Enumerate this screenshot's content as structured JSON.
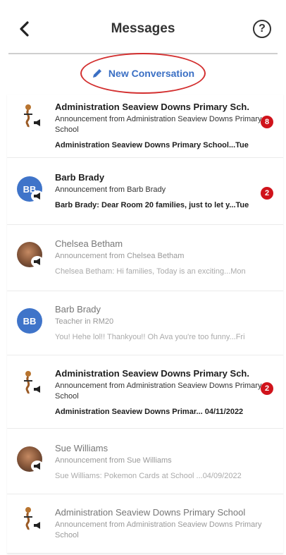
{
  "header": {
    "title": "Messages",
    "help_glyph": "?"
  },
  "new_conversation": {
    "label": "New Conversation"
  },
  "conversations": [
    {
      "name": "Administration Seaview Downs Primary Sch.",
      "subtitle": "Announcement from Administration Seaview Downs Primary School",
      "preview": "Administration Seaview Downs Primary School...Tue",
      "badge": "8",
      "avatar": "school-logo",
      "unread": true
    },
    {
      "name": "Barb Brady",
      "subtitle": "Announcement from Barb Brady",
      "preview": "Barb Brady: Dear Room 20 families, just to let y...Tue",
      "badge": "2",
      "avatar_initials": "BB",
      "unread": true
    },
    {
      "name": "Chelsea Betham",
      "subtitle": "Announcement from Chelsea Betham",
      "preview": "Chelsea Betham: Hi families, Today is an exciting...Mon",
      "avatar": "photo",
      "unread": false
    },
    {
      "name": "Barb Brady",
      "subtitle": "Teacher in RM20",
      "preview": "You! Hehe lol!! Thankyou!! Oh Ava you're too funny...Fri",
      "avatar_initials": "BB",
      "unread": false
    },
    {
      "name": "Administration Seaview Downs Primary Sch.",
      "subtitle": "Announcement from Administration Seaview Downs Primary School",
      "preview": "Administration Seaview Downs Primar... 04/11/2022",
      "badge": "2",
      "avatar": "school-logo",
      "unread": true
    },
    {
      "name": "Sue Williams",
      "subtitle": "Announcement from Sue Williams",
      "preview": "Sue Williams: Pokemon Cards at School ...04/09/2022",
      "avatar": "photo",
      "unread": false
    },
    {
      "name": "Administration Seaview Downs Primary School",
      "subtitle": "Announcement from Administration Seaview Downs Primary School",
      "avatar": "school-logo",
      "unread": false
    }
  ],
  "colors": {
    "accent": "#3a6fc4",
    "badge": "#d0131b",
    "highlight_ellipse": "#d32f2f"
  },
  "icons": {
    "back": "chevron-left-icon",
    "help": "help-circle-icon",
    "compose": "pencil-icon",
    "announcement": "megaphone-icon"
  }
}
